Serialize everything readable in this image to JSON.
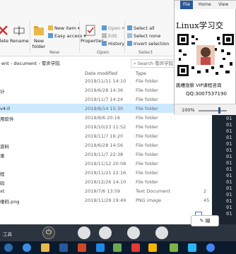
{
  "ribbon": {
    "new_item": "New item",
    "easy_access": "Easy access",
    "new_folder": "New folder",
    "new_group": "New",
    "properties": "Properties",
    "open": "Open",
    "edit": "Edit",
    "history": "History",
    "open_group": "Open",
    "select_all": "Select all",
    "select_none": "Select none",
    "invert_selection": "Invert selection",
    "select_group": "Select",
    "delete": "elete",
    "rename": "Rename"
  },
  "address": {
    "parts": [
      "ent",
      "document",
      "零声学院"
    ],
    "search_placeholder": "Search 零声学院"
  },
  "columns": {
    "date": "Date modified",
    "type": "Type"
  },
  "files": [
    {
      "name": "",
      "date": "2019/11/11 14:10",
      "type": "File folder",
      "size": ""
    },
    {
      "name": "计",
      "date": "2019/6/28 14:36",
      "type": "File folder",
      "size": ""
    },
    {
      "name": "",
      "date": "2019/11/7 14:24",
      "type": "File folder",
      "size": ""
    },
    {
      "name": "v4.0",
      "date": "2019/8/14 15:30",
      "type": "File folder",
      "size": ""
    },
    {
      "name": "用软件",
      "date": "2019/8/6 20:16",
      "type": "File folder",
      "size": ""
    },
    {
      "name": "",
      "date": "2019/10/23 11:52",
      "type": "File folder",
      "size": ""
    },
    {
      "name": "",
      "date": "2019/11/7 16:20",
      "type": "File folder",
      "size": ""
    },
    {
      "name": "资料",
      "date": "2019/6/28 14:56",
      "type": "File folder",
      "size": ""
    },
    {
      "name": "录",
      "date": "2019/11/7 22:38",
      "type": "File folder",
      "size": ""
    },
    {
      "name": "",
      "date": "2019/11/12 20:08",
      "type": "File folder",
      "size": ""
    },
    {
      "name": "程",
      "date": "2019/11/21 22:16",
      "type": "File folder",
      "size": ""
    },
    {
      "name": "码",
      "date": "2019/12/26 14:10",
      "type": "File folder",
      "size": ""
    },
    {
      "name": "xt",
      "date": "2019/7/6 13:59",
      "type": "Text Document",
      "size": "2"
    },
    {
      "name": "维码.png",
      "date": "2019/11/29 19:49",
      "type": "PNG image",
      "size": "45"
    }
  ],
  "viewer": {
    "tabs": [
      "File",
      "Home",
      "View"
    ],
    "title": "Linux学习交",
    "caption1": "跳槽涨薪 VIP课程咨询",
    "caption2": "QQ:3007537190",
    "zoom": "100%"
  },
  "terminal": {
    "lines": [
      "01",
      "01",
      "01",
      "01",
      "01",
      "01",
      "01",
      "01",
      "01",
      "01",
      "01",
      "01",
      "01",
      "01",
      "01",
      "01",
      "01"
    ]
  },
  "overlay": {
    "text": "工具",
    "edit_label": "✎ 编",
    "power_glyph": "⏻"
  },
  "colors": {
    "accent": "#2b579a",
    "selection": "#cce8ff",
    "taskbar": "#0a1a2c"
  }
}
